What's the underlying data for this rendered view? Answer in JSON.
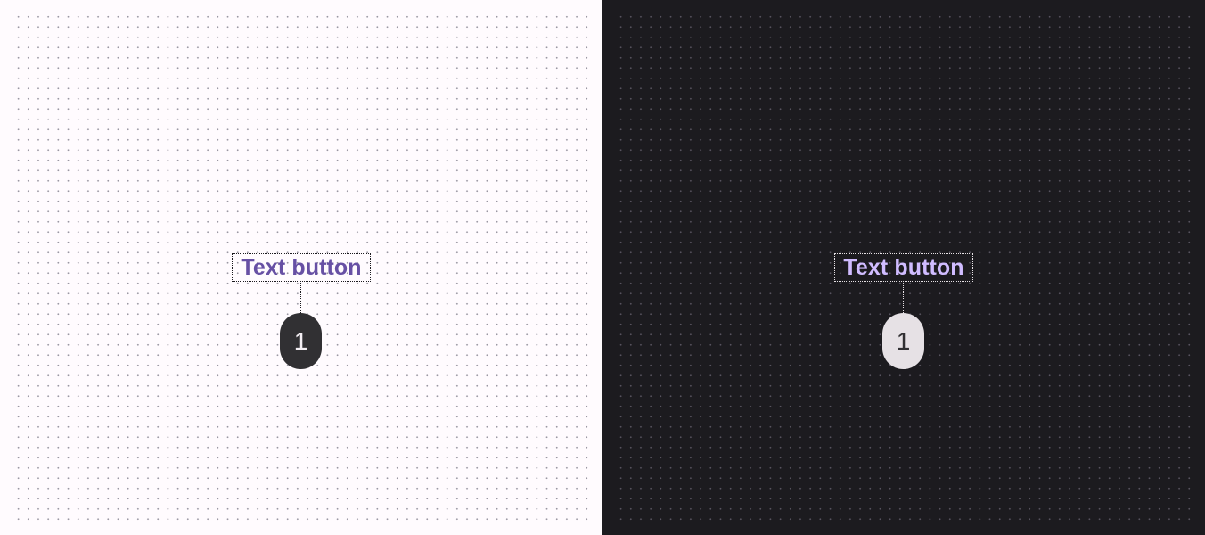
{
  "light_variant": {
    "button_label": "Text button",
    "callout_number": "1",
    "colors": {
      "background": "#fffbfe",
      "label": "#6750a4",
      "callout_fill": "#313033",
      "callout_text": "#f4eff4",
      "outline": "#1c1b1f"
    }
  },
  "dark_variant": {
    "button_label": "Text button",
    "callout_number": "1",
    "colors": {
      "background": "#1c1b1f",
      "label": "#d0bcff",
      "callout_fill": "#e6e1e5",
      "callout_text": "#313033",
      "outline": "#e6e1e5"
    }
  }
}
